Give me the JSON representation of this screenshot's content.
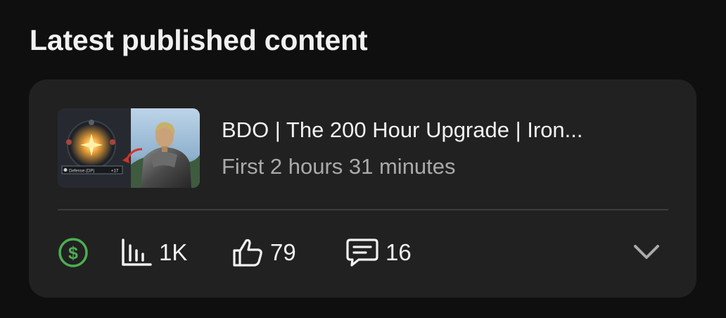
{
  "section": {
    "title": "Latest published content"
  },
  "video": {
    "title": "BDO | The 200 Hour Upgrade | Iron...",
    "subtitle": "First 2 hours 31 minutes",
    "thumbnail_icon": "video-thumbnail",
    "thumbnail_caption": "Defense (DP)",
    "thumbnail_value": "+17"
  },
  "stats": {
    "monetization_icon": "dollar-circle-icon",
    "monetization_color": "#4caf50",
    "views": "1K",
    "likes": "79",
    "comments": "16"
  },
  "colors": {
    "background": "#0f0f0f",
    "card": "#212121",
    "text": "#f1f1f1",
    "secondary_text": "#aaaaaa"
  }
}
